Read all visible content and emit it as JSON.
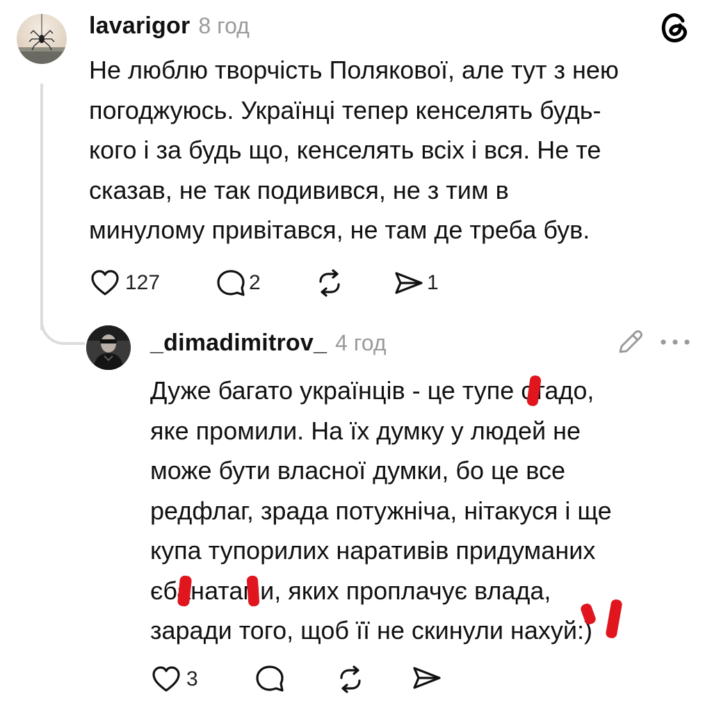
{
  "post1": {
    "username": "lavarigor",
    "time": "8 год",
    "lines": [
      "Не люблю творчість Полякової, але тут з нею",
      "погоджуюсь. Українці тепер кенселять будь-",
      "кого і за будь що, кенселять всіх і вся. Не те",
      "сказав, не так подивився, не з тим в",
      "минулому привітався, не там де треба був."
    ],
    "likes": "127",
    "replies": "2",
    "shares": "1"
  },
  "post2": {
    "username": "_dimadimitrov_",
    "time": "4 год",
    "lines": [
      "Дуже багато українців - це тупе стадо,",
      "яке промили. На їх думку у людей не",
      "може бути власної думки, бо це все",
      "редфлаг, зрада потужніча, нітакуся і ще",
      "купа тупорилих наративів придуманих",
      "єбанатами, яких проплачує влада,",
      "заради того, щоб її не скинули нахуй:)"
    ],
    "likes": "3"
  },
  "icons": {
    "app_logo": "threads-logo-icon",
    "like": "heart-icon",
    "reply": "comment-icon",
    "repost": "repost-icon",
    "share": "send-icon",
    "edit": "pencil-icon",
    "more": "more-dots-icon"
  },
  "colors": {
    "text": "#111111",
    "muted": "#9a9a9a",
    "thread_line": "#dcdcdc",
    "redaction": "#e0151e"
  }
}
